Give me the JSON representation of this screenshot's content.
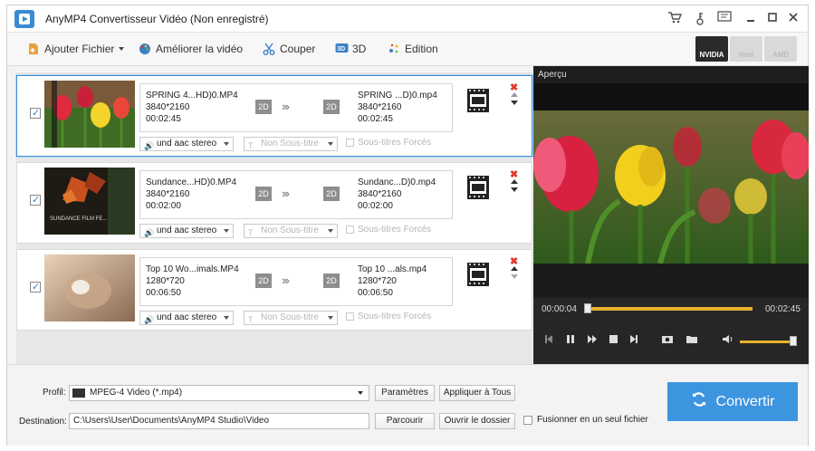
{
  "window": {
    "title": "AnyMP4 Convertisseur Vidéo (Non enregistré)",
    "titlebar_icons": [
      "cart-icon",
      "key-icon",
      "feedback-icon",
      "minimize-icon",
      "maximize-icon",
      "close-icon"
    ]
  },
  "toolbar": {
    "add_file": "Ajouter Fichier",
    "enhance": "Améliorer la vidéo",
    "cut": "Couper",
    "three_d": "3D",
    "edit": "Edition",
    "gpu": {
      "nvidia": "NVIDIA",
      "intel": "intel",
      "amd": "AMD"
    }
  },
  "items": [
    {
      "source_name": "SPRING 4...HD)0.MP4",
      "source_resolution": "3840*2160",
      "source_duration": "00:02:45",
      "target_name": "SPRING ...D)0.mp4",
      "target_resolution": "3840*2160",
      "target_duration": "00:02:45",
      "badge_in": "2D",
      "badge_out": "2D",
      "audio": "und aac stereo",
      "subtitle": "Non Sous-titre",
      "forced_subs": "Sous-titres Forcés",
      "selected": true
    },
    {
      "source_name": "Sundance...HD)0.MP4",
      "source_resolution": "3840*2160",
      "source_duration": "00:02:00",
      "target_name": "Sundanc...D)0.mp4",
      "target_resolution": "3840*2160",
      "target_duration": "00:02:00",
      "badge_in": "2D",
      "badge_out": "2D",
      "audio": "und aac stereo",
      "subtitle": "Non Sous-titre",
      "forced_subs": "Sous-titres Forcés",
      "thumb_caption": "SUNDANCE FILM FE...",
      "selected": false
    },
    {
      "source_name": "Top 10 Wo...imals.MP4",
      "source_resolution": "1280*720",
      "source_duration": "00:06:50",
      "target_name": "Top 10 ...als.mp4",
      "target_resolution": "1280*720",
      "target_duration": "00:06:50",
      "badge_in": "2D",
      "badge_out": "2D",
      "audio": "und aac stereo",
      "subtitle": "Non Sous-titre",
      "forced_subs": "Sous-titres Forcés",
      "selected": false
    }
  ],
  "preview": {
    "title": "Aperçu",
    "current_time": "00:00:04",
    "total_time": "00:02:45",
    "progress": 0.02,
    "volume": 0.9
  },
  "bottom": {
    "profile_label": "Profil:",
    "profile_value": "MPEG-4 Video (*.mp4)",
    "params_button": "Paramètres",
    "apply_all_button": "Appliquer à Tous",
    "destination_label": "Destination:",
    "destination_value": "C:\\Users\\User\\Documents\\AnyMP4 Studio\\Video",
    "browse_button": "Parcourir",
    "open_folder_button": "Ouvrir le dossier",
    "merge_label": "Fusionner en un seul fichier",
    "convert_button": "Convertir"
  },
  "colors": {
    "accent": "#3d95e0",
    "selection_border": "#3b8fdc",
    "progress": "#e8b22a",
    "delete": "#e23b2e"
  }
}
